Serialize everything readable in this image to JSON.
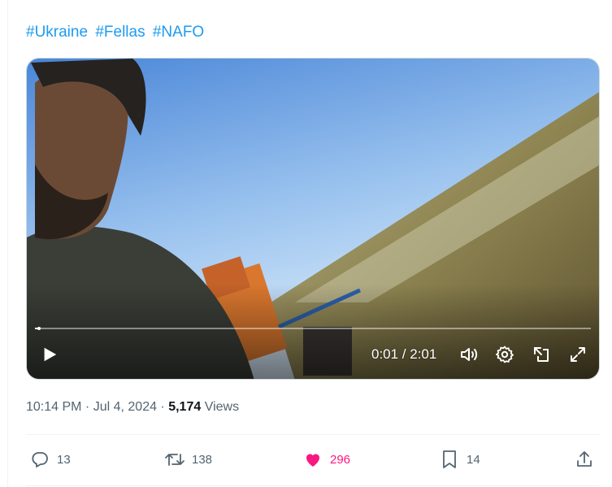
{
  "tweet": {
    "hashtags": [
      "#Ukraine",
      "#Fellas",
      "#NAFO"
    ],
    "timestamp": "10:14 PM · Jul 4, 2024 · ",
    "views_count": "5,174",
    "views_label": " Views"
  },
  "video": {
    "timecode": "0:01 / 2:01",
    "progress": 0.008
  },
  "actions": {
    "reply_count": "13",
    "retweet_count": "138",
    "like_count": "296",
    "bookmark_count": "14"
  },
  "colors": {
    "hashtag": "#1d9bf0",
    "like": "#f91880",
    "muted": "#536471"
  }
}
